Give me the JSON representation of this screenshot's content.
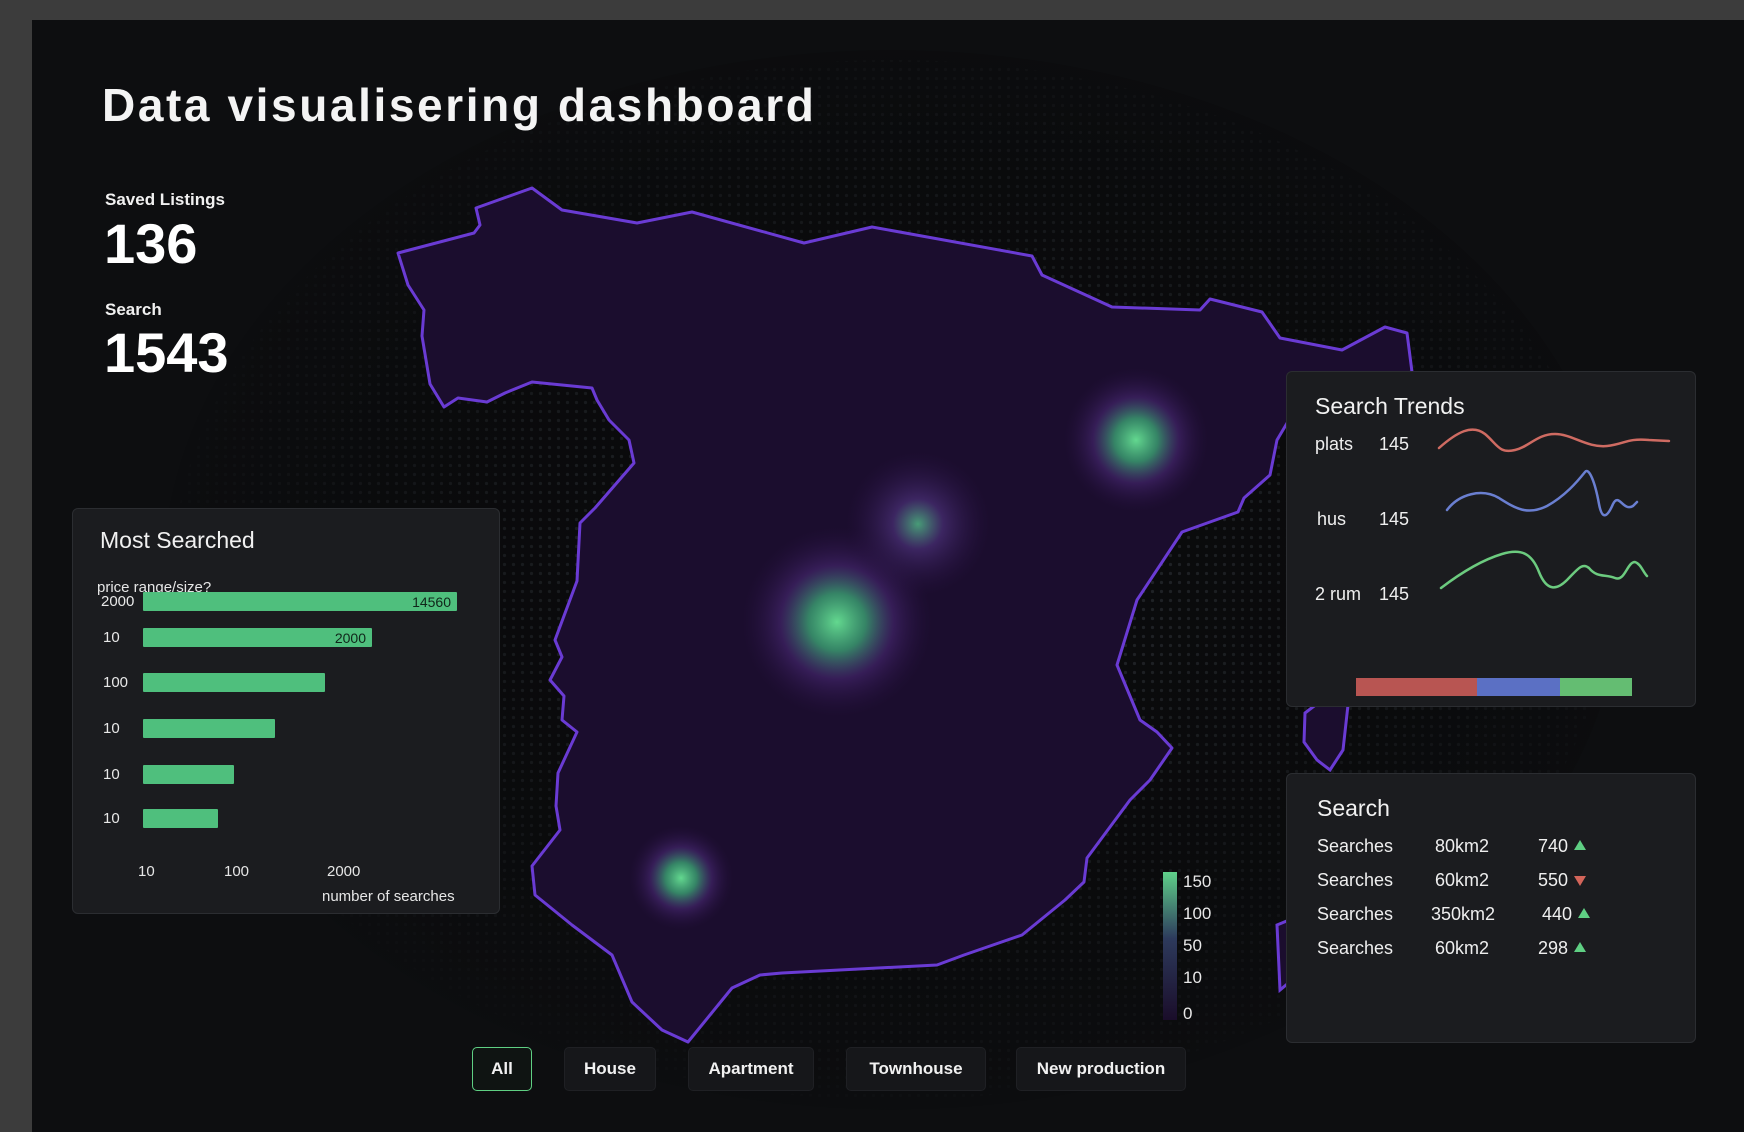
{
  "title": "Data visualisering dashboard",
  "kpis": {
    "saved_label": "Saved Listings",
    "saved_value": "136",
    "search_label": "Search",
    "search_value": "1543"
  },
  "most_searched": {
    "title": "Most Searched",
    "subtitle": "price range/size?",
    "x_axis_label": "number of searches",
    "x_ticks": [
      "10",
      "100",
      "2000"
    ],
    "rows": [
      {
        "label": "2000",
        "value_label": "14560",
        "fraction": 1.0
      },
      {
        "label": "10",
        "value_label": "2000",
        "fraction": 0.73
      },
      {
        "label": "100",
        "value_label": "",
        "fraction": 0.58
      },
      {
        "label": "10",
        "value_label": "",
        "fraction": 0.42
      },
      {
        "label": "10",
        "value_label": "",
        "fraction": 0.29
      },
      {
        "label": "10",
        "value_label": "",
        "fraction": 0.24
      }
    ]
  },
  "search_trends": {
    "title": "Search Trends",
    "items": [
      {
        "label": "plats",
        "value": "145",
        "color": "#cf6b62"
      },
      {
        "label": "hus",
        "value": "145",
        "color": "#6a7fd1"
      },
      {
        "label": "2 rum",
        "value": "145",
        "color": "#6ccb7f"
      }
    ],
    "proportion_bar": [
      {
        "color": "#b85552",
        "fraction": 0.44
      },
      {
        "color": "#5b70c4",
        "fraction": 0.3
      },
      {
        "color": "#64bd72",
        "fraction": 0.26
      }
    ]
  },
  "search_table": {
    "title": "Search",
    "rows": [
      {
        "label": "Searches",
        "size": "80km2",
        "count": "740",
        "trend": "up"
      },
      {
        "label": "Searches",
        "size": "60km2",
        "count": "550",
        "trend": "down"
      },
      {
        "label": "Searches",
        "size": "350km2",
        "count": "440",
        "trend": "up"
      },
      {
        "label": "Searches",
        "size": "60km2",
        "count": "298",
        "trend": "up"
      }
    ]
  },
  "map_legend": {
    "ticks": [
      "150",
      "100",
      "50",
      "10",
      "0"
    ],
    "colors": [
      "#5fd08a",
      "#2d2a55",
      "#1a0d2a"
    ]
  },
  "filters": [
    {
      "label": "All",
      "active": true
    },
    {
      "label": "House",
      "active": false
    },
    {
      "label": "Apartment",
      "active": false
    },
    {
      "label": "Townhouse",
      "active": false
    },
    {
      "label": "New production",
      "active": false
    }
  ]
}
